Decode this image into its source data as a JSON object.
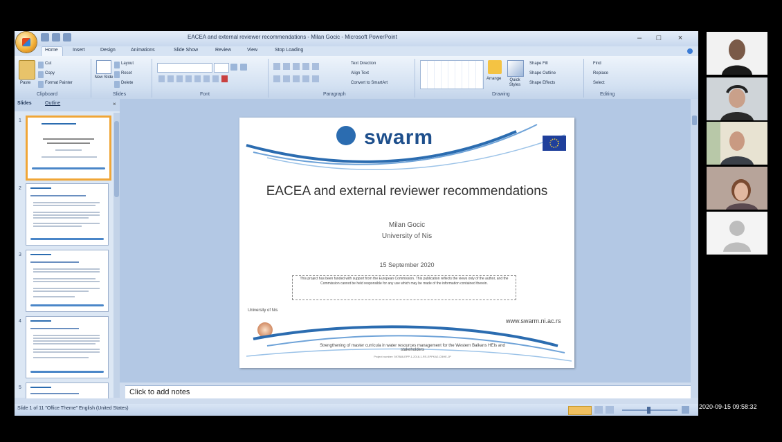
{
  "app": {
    "window_title": "EACEA and external reviewer recommendations - Milan Gocic - Microsoft PowerPoint",
    "tabs": [
      "Home",
      "Insert",
      "Design",
      "Animations",
      "Slide Show",
      "Review",
      "View",
      "Stop Loading"
    ],
    "ribbon_groups": [
      "Clipboard",
      "Slides",
      "Font",
      "Paragraph",
      "Drawing",
      "Editing"
    ],
    "ribbon_buttons": {
      "paste": "Paste",
      "cut": "Cut",
      "copy": "Copy",
      "format_painter": "Format Painter",
      "layout": "Layout",
      "reset": "Reset",
      "new_slide": "New Slide",
      "delete": "Delete",
      "text_direction": "Text Direction",
      "align_text": "Align Text",
      "convert_smartart": "Convert to SmartArt",
      "arrange": "Arrange",
      "quick_styles": "Quick Styles",
      "shape_fill": "Shape Fill",
      "shape_outline": "Shape Outline",
      "shape_effects": "Shape Effects",
      "find": "Find",
      "replace": "Replace",
      "select": "Select"
    },
    "panel_tabs": [
      "Slides",
      "Outline"
    ],
    "thumbnail_numbers": [
      "1",
      "2",
      "3",
      "4",
      "5"
    ],
    "notes_placeholder": "Click to add notes",
    "status": "Slide 1 of 11  \"Office Theme\"  English (United States)"
  },
  "slide": {
    "logo": "swarm",
    "title": "EACEA and external reviewer recommendations",
    "author": "Milan Gocic",
    "affiliation": "University of Nis",
    "date": "15 September 2020",
    "disclaimer": "This project has been funded with support from the European Commission. This publication reflects the views only of the author, and the Commission cannot be held responsible for any use which may be made of the information contained therein.",
    "university_label": "University of Nis",
    "url": "www.swarm.ni.ac.rs",
    "footer": "Strengthening of master curricula in water resources management for the Western Balkans HEIs and stakeholders",
    "footer_small": "Project number: 597888-EPP-1-2018-1-RS-EPPKA2-CBHE-JP"
  },
  "meeting": {
    "timestamp": "2020-09-15 09:58:32",
    "participants": [
      "participant-1",
      "participant-2",
      "participant-3",
      "participant-4",
      "participant-5"
    ]
  },
  "colors": {
    "ribbon": "#d3e1f2",
    "editing_area": "#b3c8e4",
    "accent": "#1e4f8c",
    "selection": "#f0a637"
  }
}
